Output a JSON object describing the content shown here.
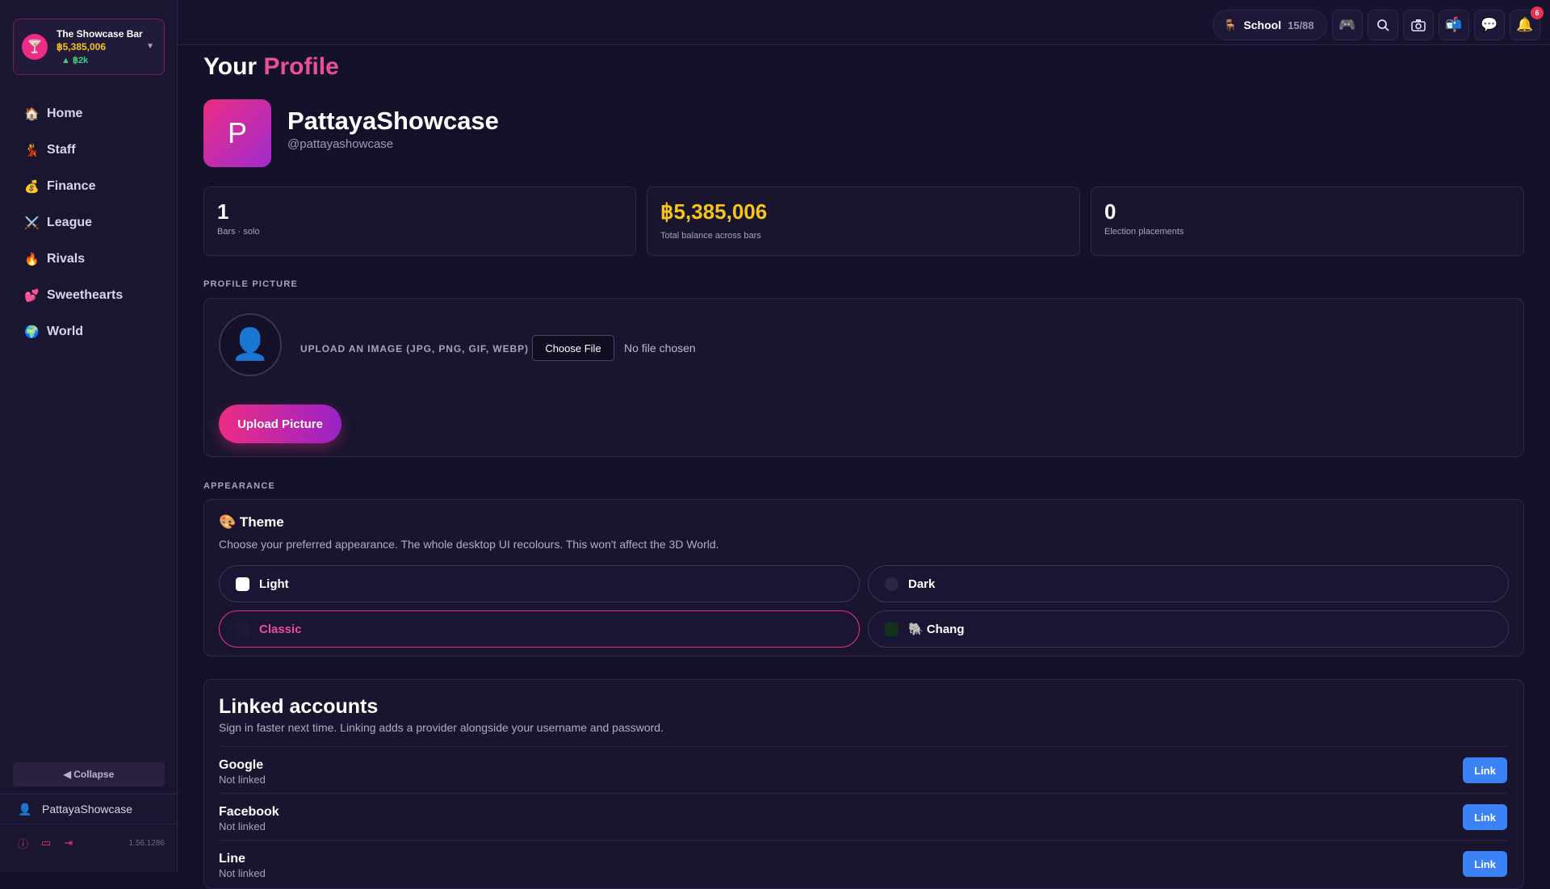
{
  "bar": {
    "name": "The Showcase Bar",
    "balance": "฿5,385,006",
    "delta": "▲ ฿2k",
    "logo": "🍸"
  },
  "nav": [
    {
      "icon": "🏠",
      "label": "Home"
    },
    {
      "icon": "💃",
      "label": "Staff"
    },
    {
      "icon": "💰",
      "label": "Finance"
    },
    {
      "icon": "⚔️",
      "label": "League"
    },
    {
      "icon": "🔥",
      "label": "Rivals"
    },
    {
      "icon": "💕",
      "label": "Sweethearts"
    },
    {
      "icon": "🌍",
      "label": "World"
    }
  ],
  "sidebar": {
    "collapse": "◀ Collapse",
    "user": "PattayaShowcase",
    "version": "1.56.1286"
  },
  "topbar": {
    "school_label": "School",
    "school_count": "15/88",
    "notif_count": "6"
  },
  "profile": {
    "title_prefix": "Your",
    "title_accent": "Profile",
    "avatar_letter": "P",
    "name": "PattayaShowcase",
    "handle": "@pattayashowcase"
  },
  "stats": [
    {
      "value": "1",
      "label": "Bars · solo"
    },
    {
      "value": "฿5,385,006",
      "label": "Total balance across bars"
    },
    {
      "value": "0",
      "label": "Election placements"
    }
  ],
  "picture": {
    "section": "PROFILE PICTURE",
    "upload_label": "UPLOAD AN IMAGE (JPG, PNG, GIF, WEBP)",
    "choose": "Choose File",
    "no_file": "No file chosen",
    "upload_btn": "Upload Picture"
  },
  "appearance": {
    "section": "APPEARANCE",
    "title": "🎨 Theme",
    "desc": "Choose your preferred appearance. The whole desktop UI recolours. This won't affect the 3D World.",
    "options": [
      {
        "label": "Light",
        "swatch": "#ffffff"
      },
      {
        "label": "Dark",
        "swatch": "#2a2740"
      },
      {
        "label": "Classic",
        "swatch": "#1f1838",
        "selected": true
      },
      {
        "label": "🐘 Chang",
        "swatch": "#16301e"
      }
    ]
  },
  "linked": {
    "title": "Linked accounts",
    "desc": "Sign in faster next time. Linking adds a provider alongside your username and password.",
    "providers": [
      {
        "name": "Google",
        "status": "Not linked",
        "action": "Link"
      },
      {
        "name": "Facebook",
        "status": "Not linked",
        "action": "Link"
      },
      {
        "name": "Line",
        "status": "Not linked",
        "action": "Link"
      }
    ]
  },
  "colors": {
    "accent": "#ec2d83",
    "gold": "#f5c518",
    "link": "#3b82f6",
    "bg": "#14112a"
  }
}
